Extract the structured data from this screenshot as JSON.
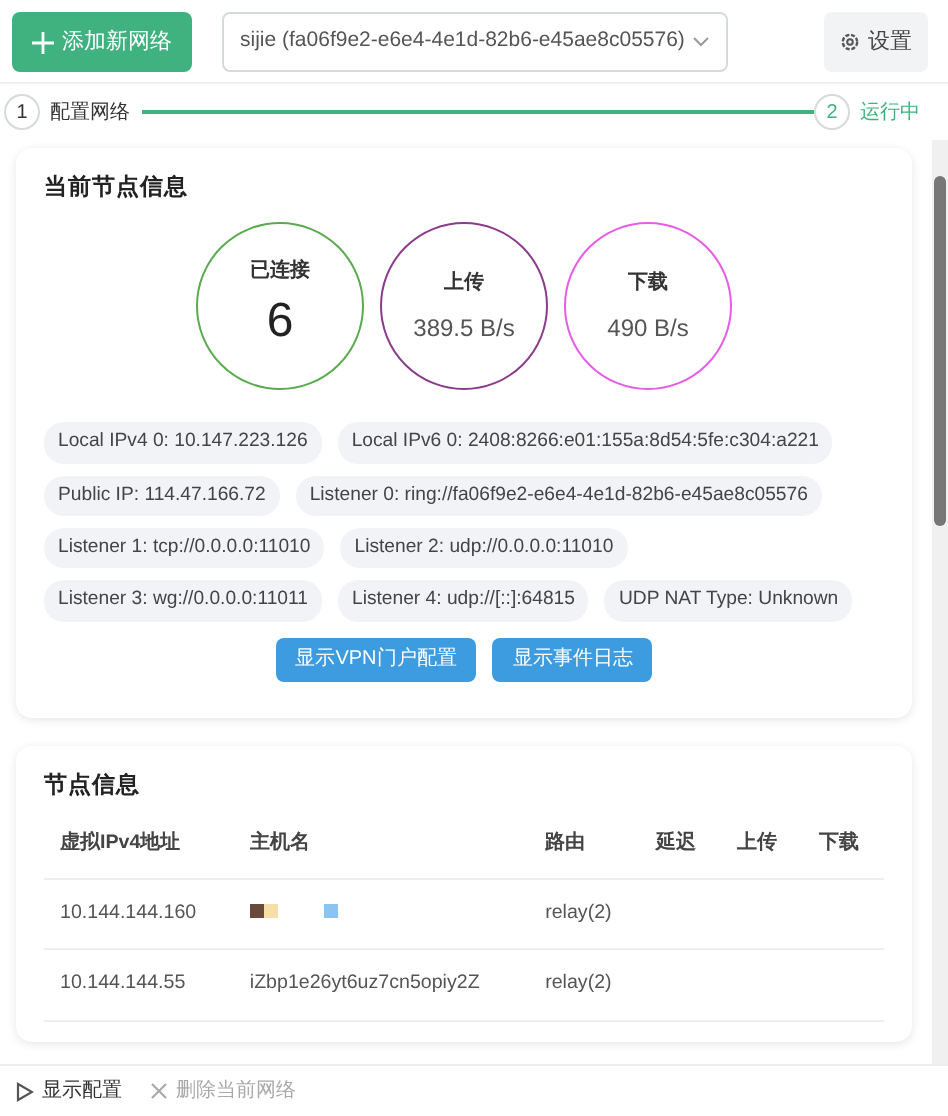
{
  "toolbar": {
    "add_button": "添加新网络",
    "network_select": "sijie (fa06f9e2-e6e4-4e1d-82b6-e45ae8c05576)",
    "settings_button": "设置"
  },
  "steps": [
    {
      "number": "1",
      "label": "配置网络",
      "active": false
    },
    {
      "number": "2",
      "label": "运行中",
      "active": true
    }
  ],
  "node_card": {
    "title": "当前节点信息",
    "stats": [
      {
        "label": "已连接",
        "value": "6",
        "color": "#5aab4f",
        "kind": "big"
      },
      {
        "label": "上传",
        "value": "389.5 B/s",
        "color": "#8b3b8b",
        "kind": "rate"
      },
      {
        "label": "下载",
        "value": "490 B/s",
        "color": "#e65ce6",
        "kind": "rate"
      }
    ],
    "tags": [
      "Local IPv4 0: 10.147.223.126",
      "Local IPv6 0: 2408:8266:e01:155a:8d54:5fe:c304:a221",
      "Public IP: 114.47.166.72",
      "Listener 0: ring://fa06f9e2-e6e4-4e1d-82b6-e45ae8c05576",
      "Listener 1: tcp://0.0.0.0:11010",
      "Listener 2: udp://0.0.0.0:11010",
      "Listener 3: wg://0.0.0.0:11011",
      "Listener 4: udp://[::]:64815",
      "UDP NAT Type: Unknown"
    ],
    "buttons": [
      "显示VPN门户配置",
      "显示事件日志"
    ]
  },
  "peers": {
    "title": "节点信息",
    "columns": [
      "虚拟IPv4地址",
      "主机名",
      "路由",
      "延迟",
      "上传",
      "下载"
    ],
    "rows": [
      {
        "kind": "glyphs",
        "ip": "10.144.144.160",
        "route": "relay(2)"
      },
      {
        "kind": "text",
        "ip": "10.144.144.55",
        "hostname": "iZbp1e26yt6uz7cn5opiy2Z",
        "route": "relay(2)"
      }
    ]
  },
  "footer": [
    {
      "label": "显示配置",
      "kind": "play",
      "disabled": false
    },
    {
      "label": "删除当前网络",
      "kind": "close",
      "disabled": true
    }
  ]
}
